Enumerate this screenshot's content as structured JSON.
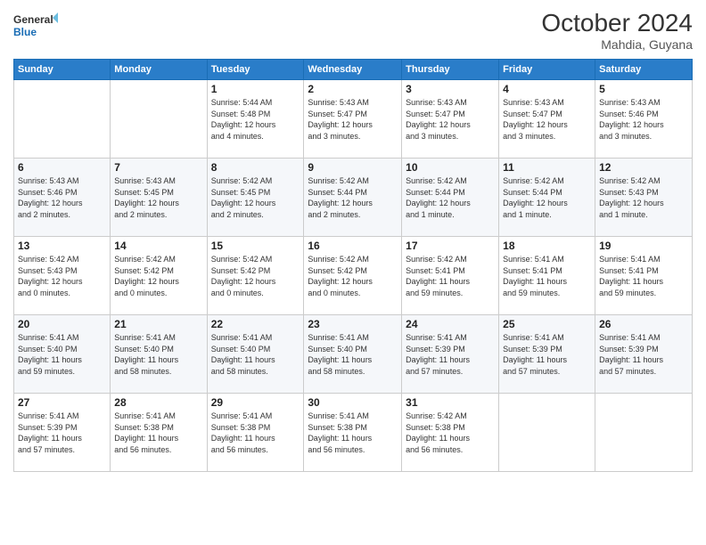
{
  "header": {
    "logo_line1": "General",
    "logo_line2": "Blue",
    "month": "October 2024",
    "location": "Mahdia, Guyana"
  },
  "days_of_week": [
    "Sunday",
    "Monday",
    "Tuesday",
    "Wednesday",
    "Thursday",
    "Friday",
    "Saturday"
  ],
  "weeks": [
    [
      {
        "day": "",
        "info": ""
      },
      {
        "day": "",
        "info": ""
      },
      {
        "day": "1",
        "info": "Sunrise: 5:44 AM\nSunset: 5:48 PM\nDaylight: 12 hours\nand 4 minutes."
      },
      {
        "day": "2",
        "info": "Sunrise: 5:43 AM\nSunset: 5:47 PM\nDaylight: 12 hours\nand 3 minutes."
      },
      {
        "day": "3",
        "info": "Sunrise: 5:43 AM\nSunset: 5:47 PM\nDaylight: 12 hours\nand 3 minutes."
      },
      {
        "day": "4",
        "info": "Sunrise: 5:43 AM\nSunset: 5:47 PM\nDaylight: 12 hours\nand 3 minutes."
      },
      {
        "day": "5",
        "info": "Sunrise: 5:43 AM\nSunset: 5:46 PM\nDaylight: 12 hours\nand 3 minutes."
      }
    ],
    [
      {
        "day": "6",
        "info": "Sunrise: 5:43 AM\nSunset: 5:46 PM\nDaylight: 12 hours\nand 2 minutes."
      },
      {
        "day": "7",
        "info": "Sunrise: 5:43 AM\nSunset: 5:45 PM\nDaylight: 12 hours\nand 2 minutes."
      },
      {
        "day": "8",
        "info": "Sunrise: 5:42 AM\nSunset: 5:45 PM\nDaylight: 12 hours\nand 2 minutes."
      },
      {
        "day": "9",
        "info": "Sunrise: 5:42 AM\nSunset: 5:44 PM\nDaylight: 12 hours\nand 2 minutes."
      },
      {
        "day": "10",
        "info": "Sunrise: 5:42 AM\nSunset: 5:44 PM\nDaylight: 12 hours\nand 1 minute."
      },
      {
        "day": "11",
        "info": "Sunrise: 5:42 AM\nSunset: 5:44 PM\nDaylight: 12 hours\nand 1 minute."
      },
      {
        "day": "12",
        "info": "Sunrise: 5:42 AM\nSunset: 5:43 PM\nDaylight: 12 hours\nand 1 minute."
      }
    ],
    [
      {
        "day": "13",
        "info": "Sunrise: 5:42 AM\nSunset: 5:43 PM\nDaylight: 12 hours\nand 0 minutes."
      },
      {
        "day": "14",
        "info": "Sunrise: 5:42 AM\nSunset: 5:42 PM\nDaylight: 12 hours\nand 0 minutes."
      },
      {
        "day": "15",
        "info": "Sunrise: 5:42 AM\nSunset: 5:42 PM\nDaylight: 12 hours\nand 0 minutes."
      },
      {
        "day": "16",
        "info": "Sunrise: 5:42 AM\nSunset: 5:42 PM\nDaylight: 12 hours\nand 0 minutes."
      },
      {
        "day": "17",
        "info": "Sunrise: 5:42 AM\nSunset: 5:41 PM\nDaylight: 11 hours\nand 59 minutes."
      },
      {
        "day": "18",
        "info": "Sunrise: 5:41 AM\nSunset: 5:41 PM\nDaylight: 11 hours\nand 59 minutes."
      },
      {
        "day": "19",
        "info": "Sunrise: 5:41 AM\nSunset: 5:41 PM\nDaylight: 11 hours\nand 59 minutes."
      }
    ],
    [
      {
        "day": "20",
        "info": "Sunrise: 5:41 AM\nSunset: 5:40 PM\nDaylight: 11 hours\nand 59 minutes."
      },
      {
        "day": "21",
        "info": "Sunrise: 5:41 AM\nSunset: 5:40 PM\nDaylight: 11 hours\nand 58 minutes."
      },
      {
        "day": "22",
        "info": "Sunrise: 5:41 AM\nSunset: 5:40 PM\nDaylight: 11 hours\nand 58 minutes."
      },
      {
        "day": "23",
        "info": "Sunrise: 5:41 AM\nSunset: 5:40 PM\nDaylight: 11 hours\nand 58 minutes."
      },
      {
        "day": "24",
        "info": "Sunrise: 5:41 AM\nSunset: 5:39 PM\nDaylight: 11 hours\nand 57 minutes."
      },
      {
        "day": "25",
        "info": "Sunrise: 5:41 AM\nSunset: 5:39 PM\nDaylight: 11 hours\nand 57 minutes."
      },
      {
        "day": "26",
        "info": "Sunrise: 5:41 AM\nSunset: 5:39 PM\nDaylight: 11 hours\nand 57 minutes."
      }
    ],
    [
      {
        "day": "27",
        "info": "Sunrise: 5:41 AM\nSunset: 5:39 PM\nDaylight: 11 hours\nand 57 minutes."
      },
      {
        "day": "28",
        "info": "Sunrise: 5:41 AM\nSunset: 5:38 PM\nDaylight: 11 hours\nand 56 minutes."
      },
      {
        "day": "29",
        "info": "Sunrise: 5:41 AM\nSunset: 5:38 PM\nDaylight: 11 hours\nand 56 minutes."
      },
      {
        "day": "30",
        "info": "Sunrise: 5:41 AM\nSunset: 5:38 PM\nDaylight: 11 hours\nand 56 minutes."
      },
      {
        "day": "31",
        "info": "Sunrise: 5:42 AM\nSunset: 5:38 PM\nDaylight: 11 hours\nand 56 minutes."
      },
      {
        "day": "",
        "info": ""
      },
      {
        "day": "",
        "info": ""
      }
    ]
  ]
}
